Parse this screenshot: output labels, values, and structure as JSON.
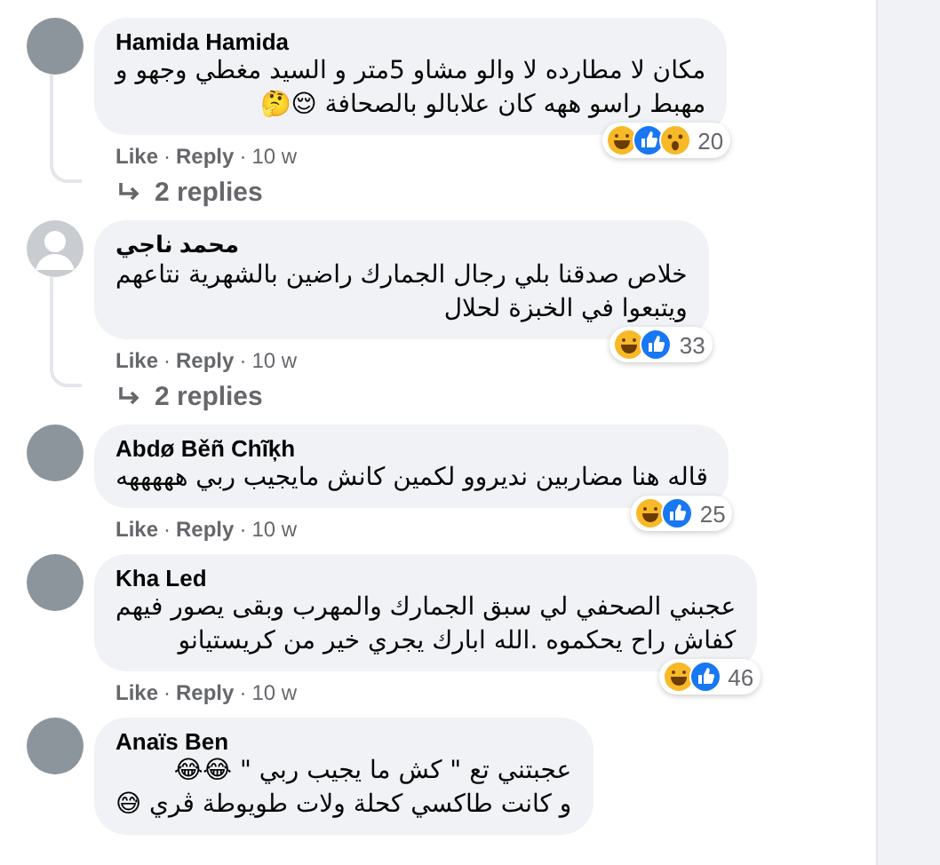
{
  "comments": [
    {
      "author": "Hamida Hamida",
      "default_avatar": false,
      "text": "مكان لا مطارده لا والو مشاو 5متر و السيد مغطي وجهو و\nمهبط راسو ههه كان علابالو بالصحافة 😌🤔",
      "reactions": [
        {
          "kind": "haha"
        },
        {
          "kind": "like"
        },
        {
          "kind": "wow"
        }
      ],
      "reaction_count": "20",
      "like": "Like",
      "separator_1": "·",
      "reply": "Reply",
      "separator_2": "·",
      "time": "10 w",
      "replies": "2 replies"
    },
    {
      "author": "محمد ناجي",
      "default_avatar": true,
      "text": "خلاص صدقنا بلي رجال الجمارك راضين بالشهرية نتاعهم\nويتبعوا في الخبزة لحلال",
      "reactions": [
        {
          "kind": "haha"
        },
        {
          "kind": "like"
        }
      ],
      "reaction_count": "33",
      "like": "Like",
      "separator_1": "·",
      "reply": "Reply",
      "separator_2": "·",
      "time": "10 w",
      "replies": "2 replies"
    },
    {
      "author": "Abdø Běñ Chĩķh",
      "default_avatar": false,
      "text": "قاله هنا مضاربين نديروو لكمين كانش مايجيب ربي هههههه",
      "reactions": [
        {
          "kind": "haha"
        },
        {
          "kind": "like"
        }
      ],
      "reaction_count": "25",
      "like": "Like",
      "separator_1": "·",
      "reply": "Reply",
      "separator_2": "·",
      "time": "10 w"
    },
    {
      "author": "Kha Led",
      "default_avatar": false,
      "text": "عجبني الصحفي لي سبق الجمارك والمهرب وبقى يصور فيهم\nكفاش راح يحكموه .الله ابارك يجري خير من كريستيانو",
      "reactions": [
        {
          "kind": "haha"
        },
        {
          "kind": "like"
        }
      ],
      "reaction_count": "46",
      "like": "Like",
      "separator_1": "·",
      "reply": "Reply",
      "separator_2": "·",
      "time": "10 w"
    },
    {
      "author": "Anaïs Ben",
      "default_avatar": false,
      "text": "عجبتني تع \" كش ما يجيب ربي \" 😂😂\nو كانت طاكسي كحلة ولات طويوطة ڨري 😅"
    }
  ]
}
